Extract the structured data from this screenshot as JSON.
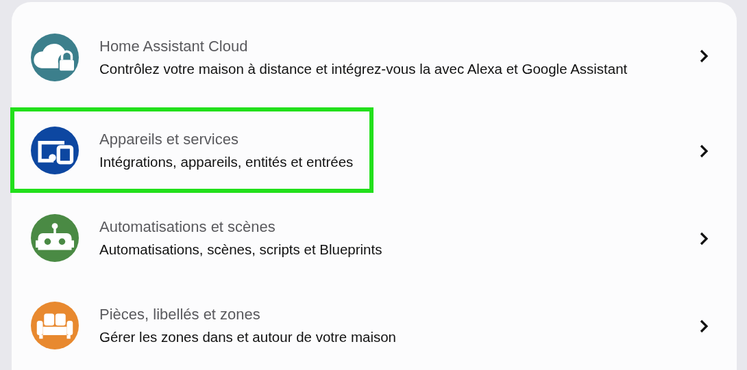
{
  "settings_list": [
    {
      "kind": "cloud",
      "color": "#3c7f8c",
      "title": "Home Assistant Cloud",
      "description": "Contrôlez votre maison à distance et intégrez-vous la avec Alexa et Google Assistant",
      "highlighted": false
    },
    {
      "kind": "devices",
      "color": "#0d47a1",
      "title": "Appareils et services",
      "description": "Intégrations, appareils, entités et entrées",
      "highlighted": true
    },
    {
      "kind": "robot",
      "color": "#4a8a44",
      "title": "Automatisations et scènes",
      "description": "Automatisations, scènes, scripts et Blueprints",
      "highlighted": false
    },
    {
      "kind": "sofa",
      "color": "#e8892f",
      "title": "Pièces, libellés et zones",
      "description": "Gérer les zones dans et autour de votre maison",
      "highlighted": false
    }
  ]
}
